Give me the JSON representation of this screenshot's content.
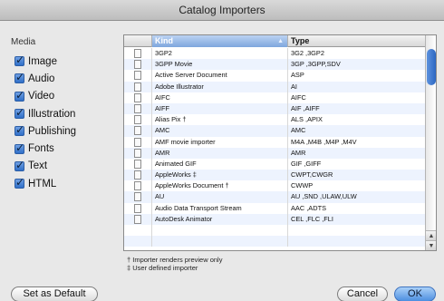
{
  "window": {
    "title": "Catalog Importers"
  },
  "media": {
    "label": "Media",
    "items": [
      {
        "label": "Image",
        "checked": true
      },
      {
        "label": "Audio",
        "checked": true
      },
      {
        "label": "Video",
        "checked": true
      },
      {
        "label": "Illustration",
        "checked": true
      },
      {
        "label": "Publishing",
        "checked": true
      },
      {
        "label": "Fonts",
        "checked": true
      },
      {
        "label": "Text",
        "checked": true
      },
      {
        "label": "HTML",
        "checked": true
      }
    ]
  },
  "table": {
    "columns": {
      "kind": "Kind",
      "type": "Type"
    },
    "sort_indicator": "▲",
    "rows": [
      {
        "kind": "3GP2",
        "type": "3G2 ,3GP2",
        "icon": "blank-doc-icon"
      },
      {
        "kind": "3GPP Movie",
        "type": "3GP ,3GPP,SDV",
        "icon": "movie-doc-icon"
      },
      {
        "kind": "Active Server Document",
        "type": "ASP",
        "icon": "web-doc-icon"
      },
      {
        "kind": "Adobe Illustrator",
        "type": "AI",
        "icon": "illustrator-doc-icon"
      },
      {
        "kind": "AIFC",
        "type": "AIFC",
        "icon": "audio-doc-icon"
      },
      {
        "kind": "AIFF",
        "type": "AIF ,AIFF",
        "icon": "audio-doc-icon"
      },
      {
        "kind": "Alias Pix †",
        "type": "ALS ,APIX",
        "icon": "image-doc-icon"
      },
      {
        "kind": "AMC",
        "type": "AMC",
        "icon": "blank-doc-icon"
      },
      {
        "kind": "AMF movie importer",
        "type": "M4A ,M4B ,M4P ,M4V",
        "icon": "audio-doc-icon"
      },
      {
        "kind": "AMR",
        "type": "AMR",
        "icon": "audio-doc-icon"
      },
      {
        "kind": "Animated GIF",
        "type": "GIF ,GIFF",
        "icon": "blank-doc-icon"
      },
      {
        "kind": "AppleWorks ‡",
        "type": "CWPT,CWGR",
        "icon": "image-doc-icon"
      },
      {
        "kind": "AppleWorks Document †",
        "type": "CWWP",
        "icon": "text-doc-icon"
      },
      {
        "kind": "AU",
        "type": "AU ,SND ,ULAW,ULW",
        "icon": "audio-doc-icon"
      },
      {
        "kind": "Audio Data Transport Stream",
        "type": "AAC ,ADTS",
        "icon": "audio-doc-icon"
      },
      {
        "kind": "AutoDesk Animator",
        "type": "CEL ,FLC ,FLI",
        "icon": "blank-doc-icon"
      },
      {
        "kind": "",
        "type": "",
        "icon": ""
      },
      {
        "kind": "",
        "type": "",
        "icon": ""
      }
    ]
  },
  "footnotes": {
    "note1": "† Importer renders preview only",
    "note2": "‡ User defined importer"
  },
  "buttons": {
    "set_default": "Set as Default",
    "cancel": "Cancel",
    "ok": "OK"
  },
  "colors": {
    "accent": "#3f7fd8",
    "row_alt": "#edf3fe"
  }
}
